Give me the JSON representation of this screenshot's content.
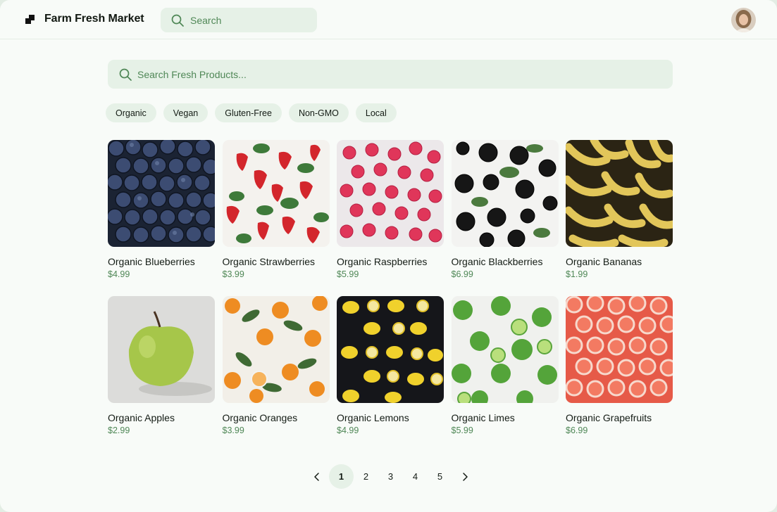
{
  "header": {
    "app_title": "Farm Fresh Market",
    "search_placeholder": "Search",
    "avatar_icon": "user-avatar"
  },
  "search": {
    "placeholder": "Search Fresh Products..."
  },
  "filters": [
    "Organic",
    "Vegan",
    "Gluten-Free",
    "Non-GMO",
    "Local"
  ],
  "products": [
    {
      "name": "Organic Blueberries",
      "price": "$4.99"
    },
    {
      "name": "Organic Strawberries",
      "price": "$3.99"
    },
    {
      "name": "Organic Raspberries",
      "price": "$5.99"
    },
    {
      "name": "Organic Blackberries",
      "price": "$6.99"
    },
    {
      "name": "Organic Bananas",
      "price": "$1.99"
    },
    {
      "name": "Organic Apples",
      "price": "$2.99"
    },
    {
      "name": "Organic Oranges",
      "price": "$3.99"
    },
    {
      "name": "Organic Lemons",
      "price": "$4.99"
    },
    {
      "name": "Organic Limes",
      "price": "$5.99"
    },
    {
      "name": "Organic Grapefruits",
      "price": "$6.99"
    }
  ],
  "pagination": {
    "pages": [
      "1",
      "2",
      "3",
      "4",
      "5"
    ],
    "current": "1",
    "prev_icon": "chevron-left-icon",
    "next_icon": "chevron-right-icon"
  },
  "colors": {
    "accent": "#4f8756",
    "chip_bg": "#e6f1e7",
    "page_bg": "#f8fbf8"
  }
}
